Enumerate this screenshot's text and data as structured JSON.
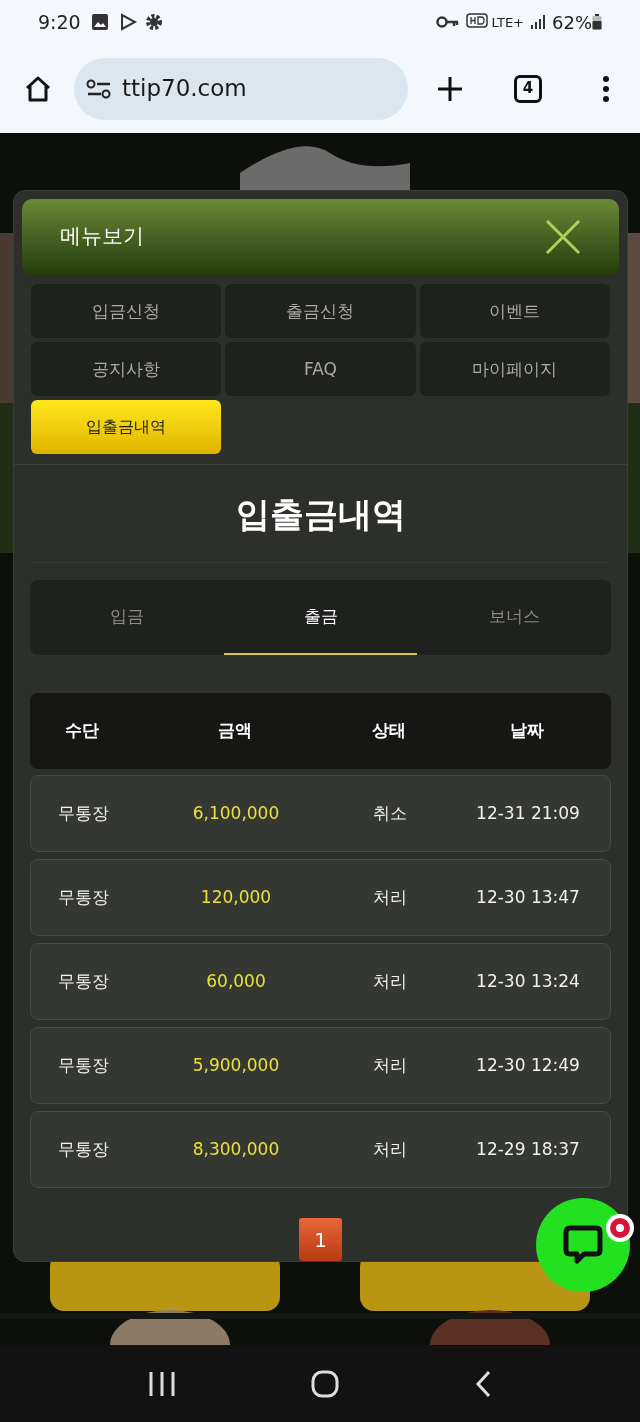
{
  "status_bar": {
    "time": "9:20",
    "network": "LTE+",
    "battery": "62%"
  },
  "browser": {
    "url": "ttip70.com",
    "tab_count": "4"
  },
  "menu": {
    "title": "메뉴보기",
    "items": [
      {
        "label": "입금신청",
        "selected": false
      },
      {
        "label": "출금신청",
        "selected": false
      },
      {
        "label": "이벤트",
        "selected": false
      },
      {
        "label": "공지사항",
        "selected": false
      },
      {
        "label": "FAQ",
        "selected": false
      },
      {
        "label": "마이페이지",
        "selected": false
      },
      {
        "label": "입출금내역",
        "selected": true
      }
    ]
  },
  "page_title": "입출금내역",
  "tabs": [
    {
      "label": "입금",
      "selected": false
    },
    {
      "label": "출금",
      "selected": true
    },
    {
      "label": "보너스",
      "selected": false
    }
  ],
  "table": {
    "columns": [
      "수단",
      "금액",
      "상태",
      "날짜"
    ],
    "rows": [
      [
        "무통장",
        "6,100,000",
        "취소",
        "12-31 21:09"
      ],
      [
        "무통장",
        "120,000",
        "처리",
        "12-30 13:47"
      ],
      [
        "무통장",
        "60,000",
        "처리",
        "12-30 13:24"
      ],
      [
        "무통장",
        "5,900,000",
        "처리",
        "12-30 12:49"
      ],
      [
        "무통장",
        "8,300,000",
        "처리",
        "12-29 18:37"
      ]
    ]
  },
  "pagination": [
    {
      "label": "1",
      "selected": true
    }
  ]
}
